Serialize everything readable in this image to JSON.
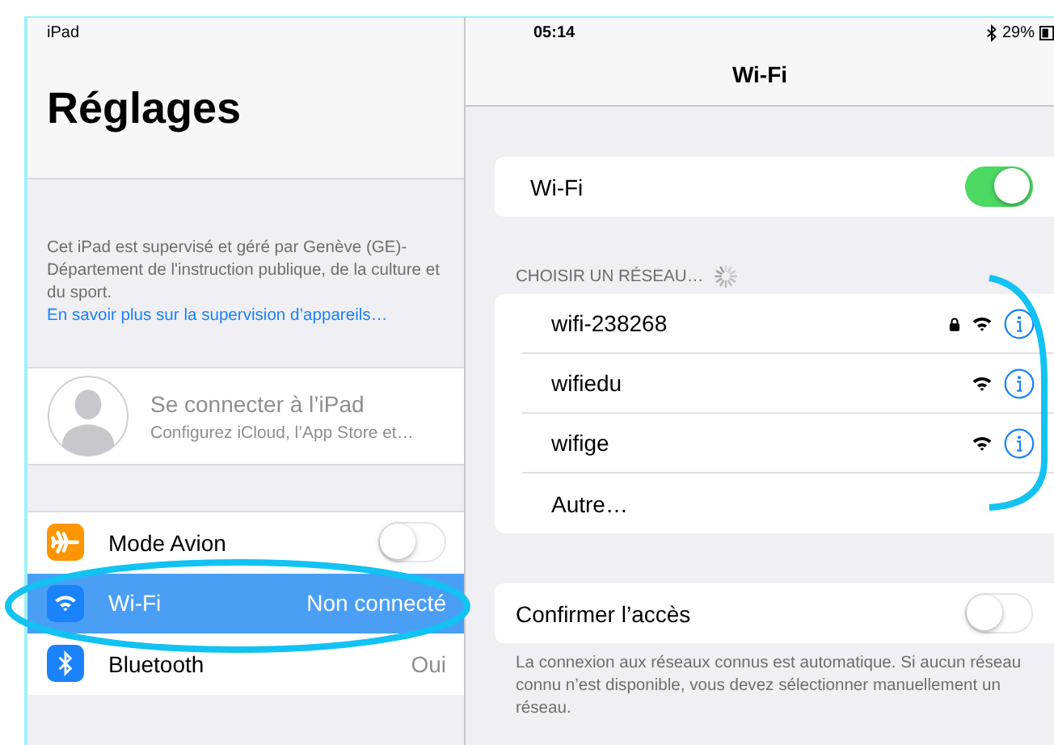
{
  "status_bar": {
    "device": "iPad",
    "time": "05:14",
    "battery": "29%"
  },
  "sidebar": {
    "title": "Réglages",
    "supervision_note": "Cet iPad est supervisé et géré par Genève (GE)-Département de l'instruction publique, de la culture et du sport.",
    "supervision_link": "En savoir plus sur la supervision d’appareils…",
    "account": {
      "title": "Se connecter à l’iPad",
      "subtitle": "Configurez iCloud, l’App Store et…"
    },
    "items": [
      {
        "kind": "airplane",
        "label": "Mode Avion",
        "on": false,
        "selected": false
      },
      {
        "kind": "wifi",
        "label": "Wi-Fi",
        "value": "Non connecté",
        "selected": true
      },
      {
        "kind": "bluetooth",
        "label": "Bluetooth",
        "value": "Oui",
        "selected": false
      }
    ]
  },
  "detail": {
    "title": "Wi-Fi",
    "wifi_toggle": {
      "label": "Wi-Fi",
      "on": true
    },
    "section_header": "CHOISIR UN RÉSEAU…",
    "networks": [
      {
        "kind": "network",
        "name": "wifi-238268",
        "locked": true
      },
      {
        "kind": "network",
        "name": "wifiedu",
        "locked": false
      },
      {
        "kind": "network",
        "name": "wifige",
        "locked": false
      },
      {
        "kind": "other",
        "name": "Autre…"
      }
    ],
    "ask_to_join": {
      "label": "Confirmer l’accès",
      "on": false
    },
    "footer": "La connexion aux réseaux connus est automatique. Si aucun réseau connu n’est disponible, vous devez sélectionner manuellement un réseau."
  }
}
